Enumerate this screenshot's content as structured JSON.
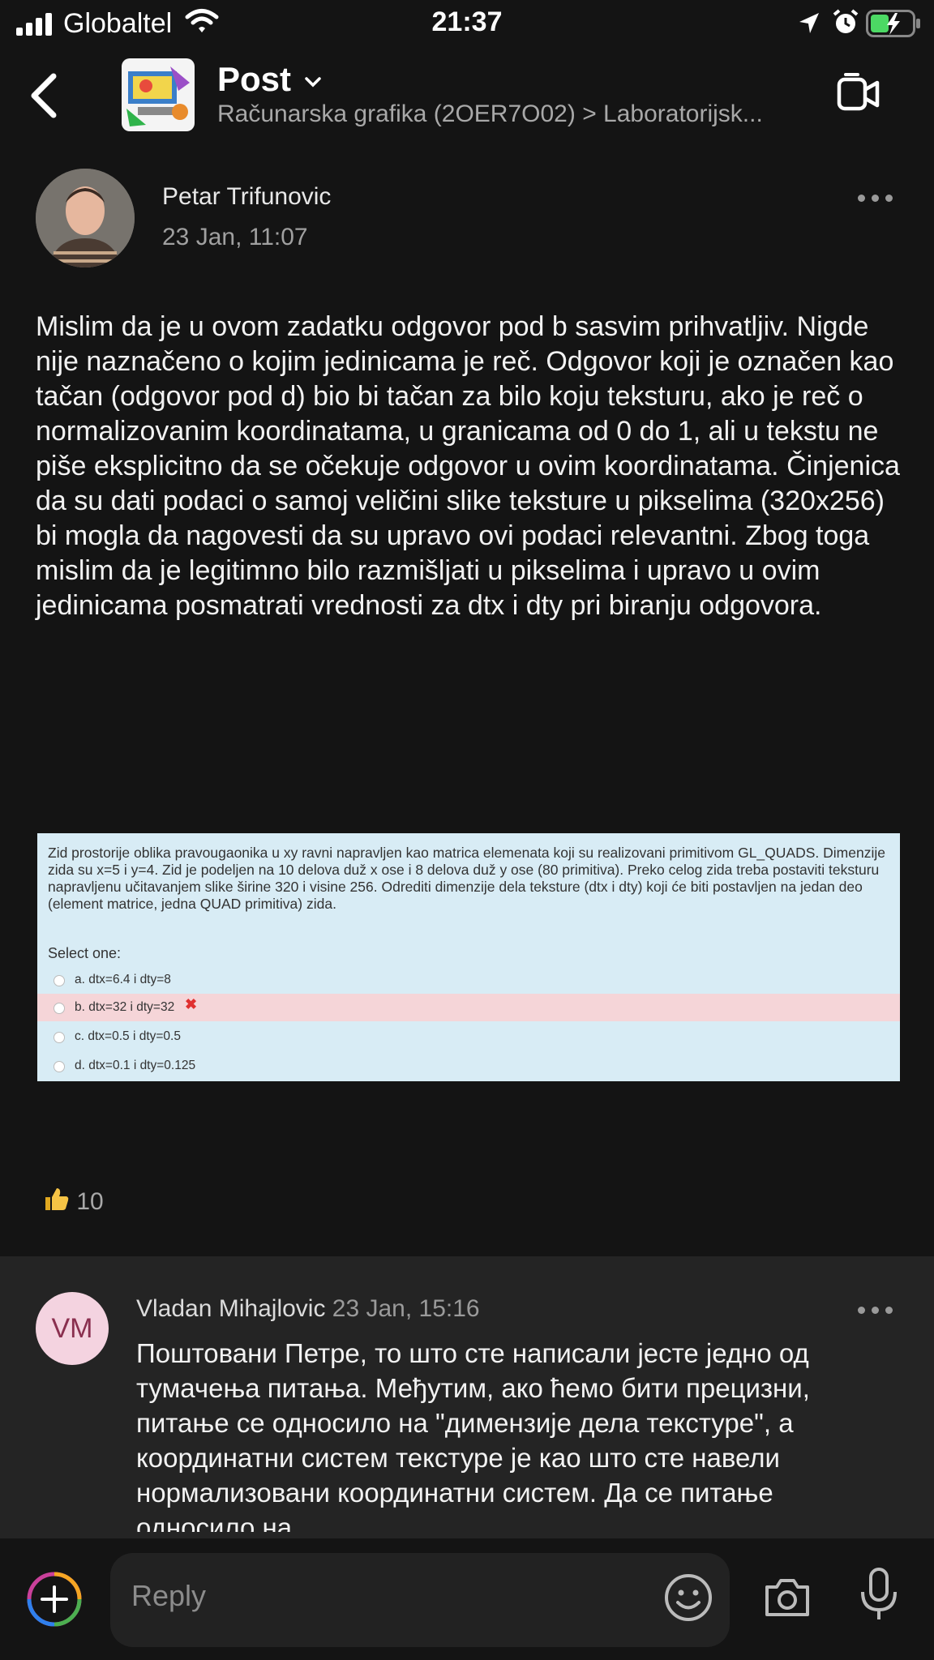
{
  "status_bar": {
    "carrier": "Globaltel",
    "time": "21:37"
  },
  "header": {
    "title": "Post",
    "breadcrumb": "Računarska grafika (2OER7O02) > Laboratorijsk..."
  },
  "post": {
    "author": "Petar Trifunovic",
    "date": "23 Jan, 11:07",
    "body": "Mislim da je u ovom zadatku odgovor pod b sasvim prihvatljiv. Nigde nije naznačeno o kojim jedinicama je reč. Odgovor koji je označen kao tačan (odgovor pod d) bio bi tačan za bilo koju teksturu, ako je reč o normalizovanim koordinatama, u granicama od 0 do 1, ali u tekstu ne piše eksplicitno da se očekuje odgovor u ovim koordinatama. Činjenica da su dati podaci o samoj veličini slike teksture u pikselima (320x256) bi mogla da nagovesti da su upravo ovi podaci relevantni. Zbog toga mislim da je legitimno bilo razmišljati u pikselima i upravo u ovim jedinicama posmatrati vrednosti za dtx i dty pri biranju odgovora.",
    "attachment": {
      "question": "Zid prostorije oblika pravougaonika u xy ravni napravljen kao matrica elemenata koji su realizovani primitivom GL_QUADS. Dimenzije zida su x=5 i y=4. Zid je podeljen na 10 delova duž x ose i 8 delova duž y ose (80 primitiva). Preko celog zida treba postaviti teksturu napravljenu učitavanjem slike širine 320 i visine 256. Odrediti dimenzije dela teksture (dtx i dty) koji će biti postavljen na jedan deo (element matrice, jedna QUAD primitiva) zida.",
      "select_label": "Select one:",
      "options": [
        {
          "label": "a. dtx=6.4 i dty=8"
        },
        {
          "label": "b. dtx=32 i dty=32",
          "marked_wrong": "✖"
        },
        {
          "label": "c. dtx=0.5 i dty=0.5"
        },
        {
          "label": "d. dtx=0.1 i dty=0.125"
        }
      ]
    },
    "likes": "10"
  },
  "reply": {
    "initials": "VM",
    "author": "Vladan Mihajlovic",
    "date": "23 Jan, 15:16",
    "body": "Поштовани Петре, то што сте написали јесте једно од тумачења питања. Међутим, ако ћемо бити прецизни, питање се односило на \"димензије дела текстуре\", а координатни систем текстуре је као што сте навели нормализовани координатни систем. Да се питање односило на"
  },
  "composer": {
    "placeholder": "Reply"
  },
  "colors": {
    "background": "#141414",
    "reply_background": "#242424",
    "battery": "#4cd964",
    "quiz_background": "#d8ecf5",
    "wrong_option": "#f5d5d8"
  }
}
